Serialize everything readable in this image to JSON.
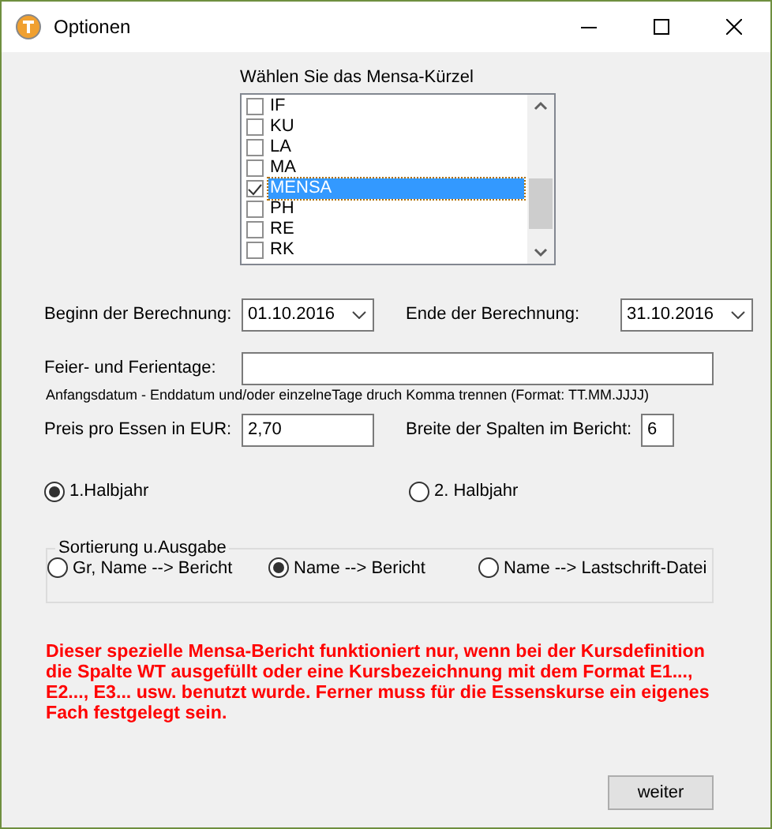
{
  "window": {
    "title": "Optionen"
  },
  "mensa_list": {
    "label": "Wählen Sie das Mensa-Kürzel",
    "items": [
      {
        "label": "IF",
        "checked": false,
        "selected": false
      },
      {
        "label": "KU",
        "checked": false,
        "selected": false
      },
      {
        "label": "LA",
        "checked": false,
        "selected": false
      },
      {
        "label": "MA",
        "checked": false,
        "selected": false
      },
      {
        "label": "MENSA",
        "checked": true,
        "selected": true
      },
      {
        "label": "PH",
        "checked": false,
        "selected": false
      },
      {
        "label": "RE",
        "checked": false,
        "selected": false
      },
      {
        "label": "RK",
        "checked": false,
        "selected": false
      }
    ]
  },
  "start_date": {
    "label": "Beginn der Berechnung:",
    "value": "01.10.2016"
  },
  "end_date": {
    "label": "Ende der Berechnung:",
    "value": "31.10.2016"
  },
  "holidays": {
    "label": "Feier- und Ferientage:",
    "hint": "Anfangsdatum - Enddatum und/oder einzelneTage druch Komma trennen (Format: TT.MM.JJJJ)"
  },
  "price": {
    "label": "Preis pro Essen in EUR:",
    "value": "2,70"
  },
  "column_width": {
    "label": "Breite der Spalten im Bericht:",
    "value": "6"
  },
  "half_year": [
    {
      "label": "1.Halbjahr",
      "selected": true
    },
    {
      "label": "2. Halbjahr",
      "selected": false
    }
  ],
  "sorting": {
    "legend": "Sortierung u.Ausgabe",
    "options": [
      {
        "label": "Gr, Name --> Bericht",
        "selected": false
      },
      {
        "label": "Name --> Bericht",
        "selected": true
      },
      {
        "label": "Name --> Lastschrift-Datei",
        "selected": false
      }
    ]
  },
  "warning": "Dieser spezielle Mensa-Bericht funktioniert nur, wenn bei der Kursdefinition die Spalte WT ausgefüllt oder eine Kursbezeichnung mit dem Format E1..., E2..., E3... usw. benutzt wurde. Ferner muss für die Essenskurse ein eigenes Fach festgelegt sein.",
  "buttons": [
    {
      "label": "weiter"
    }
  ]
}
